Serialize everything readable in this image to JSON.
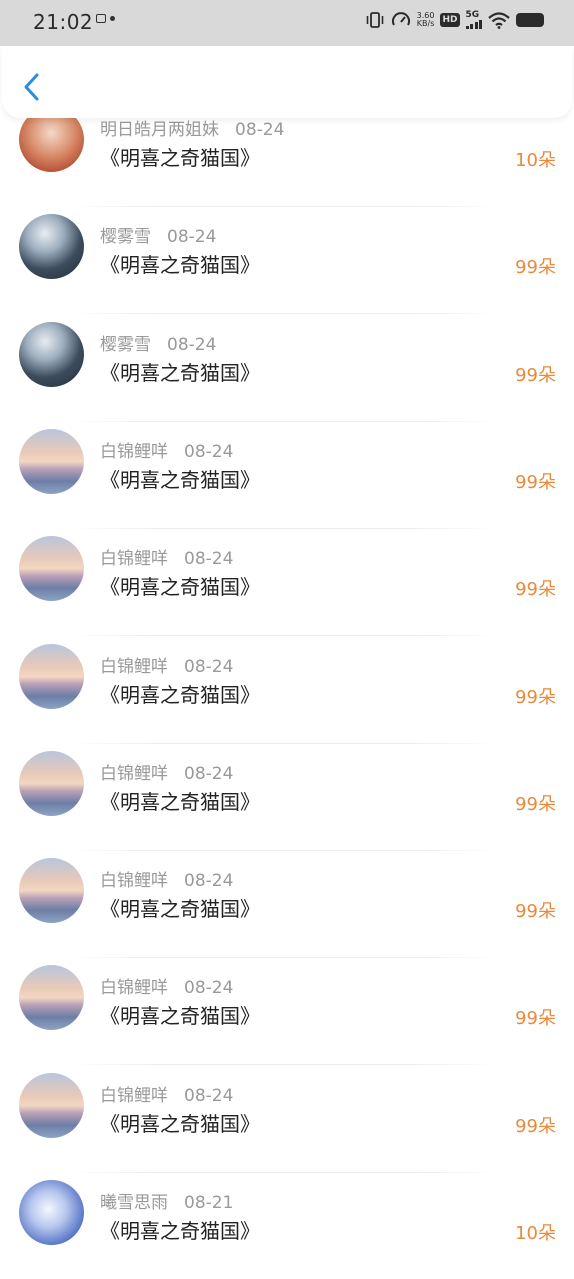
{
  "status_bar": {
    "time": "21:02",
    "net_speed_value": "3.60",
    "net_speed_unit": "KB/s",
    "hd_label": "HD",
    "network_label": "5G"
  },
  "nav": {
    "back_icon": "chevron-left-icon",
    "accent": "#2a8de0"
  },
  "colors": {
    "amount": "#e9893c",
    "name": "#999999",
    "title": "#222222"
  },
  "rows": [
    {
      "name": "明日皓月两姐妹",
      "date": "08-24",
      "title": "《明喜之奇猫国》",
      "amount": "10朵",
      "avatar": "red"
    },
    {
      "name": "樱雾雪",
      "date": "08-24",
      "title": "《明喜之奇猫国》",
      "amount": "99朵",
      "avatar": "dark"
    },
    {
      "name": "樱雾雪",
      "date": "08-24",
      "title": "《明喜之奇猫国》",
      "amount": "99朵",
      "avatar": "dark"
    },
    {
      "name": "白锦鲤咩",
      "date": "08-24",
      "title": "《明喜之奇猫国》",
      "amount": "99朵",
      "avatar": "sunset"
    },
    {
      "name": "白锦鲤咩",
      "date": "08-24",
      "title": "《明喜之奇猫国》",
      "amount": "99朵",
      "avatar": "sunset"
    },
    {
      "name": "白锦鲤咩",
      "date": "08-24",
      "title": "《明喜之奇猫国》",
      "amount": "99朵",
      "avatar": "sunset"
    },
    {
      "name": "白锦鲤咩",
      "date": "08-24",
      "title": "《明喜之奇猫国》",
      "amount": "99朵",
      "avatar": "sunset"
    },
    {
      "name": "白锦鲤咩",
      "date": "08-24",
      "title": "《明喜之奇猫国》",
      "amount": "99朵",
      "avatar": "sunset"
    },
    {
      "name": "白锦鲤咩",
      "date": "08-24",
      "title": "《明喜之奇猫国》",
      "amount": "99朵",
      "avatar": "sunset"
    },
    {
      "name": "白锦鲤咩",
      "date": "08-24",
      "title": "《明喜之奇猫国》",
      "amount": "99朵",
      "avatar": "sunset"
    },
    {
      "name": "曦雪思雨",
      "date": "08-21",
      "title": "《明喜之奇猫国》",
      "amount": "10朵",
      "avatar": "blue"
    }
  ]
}
